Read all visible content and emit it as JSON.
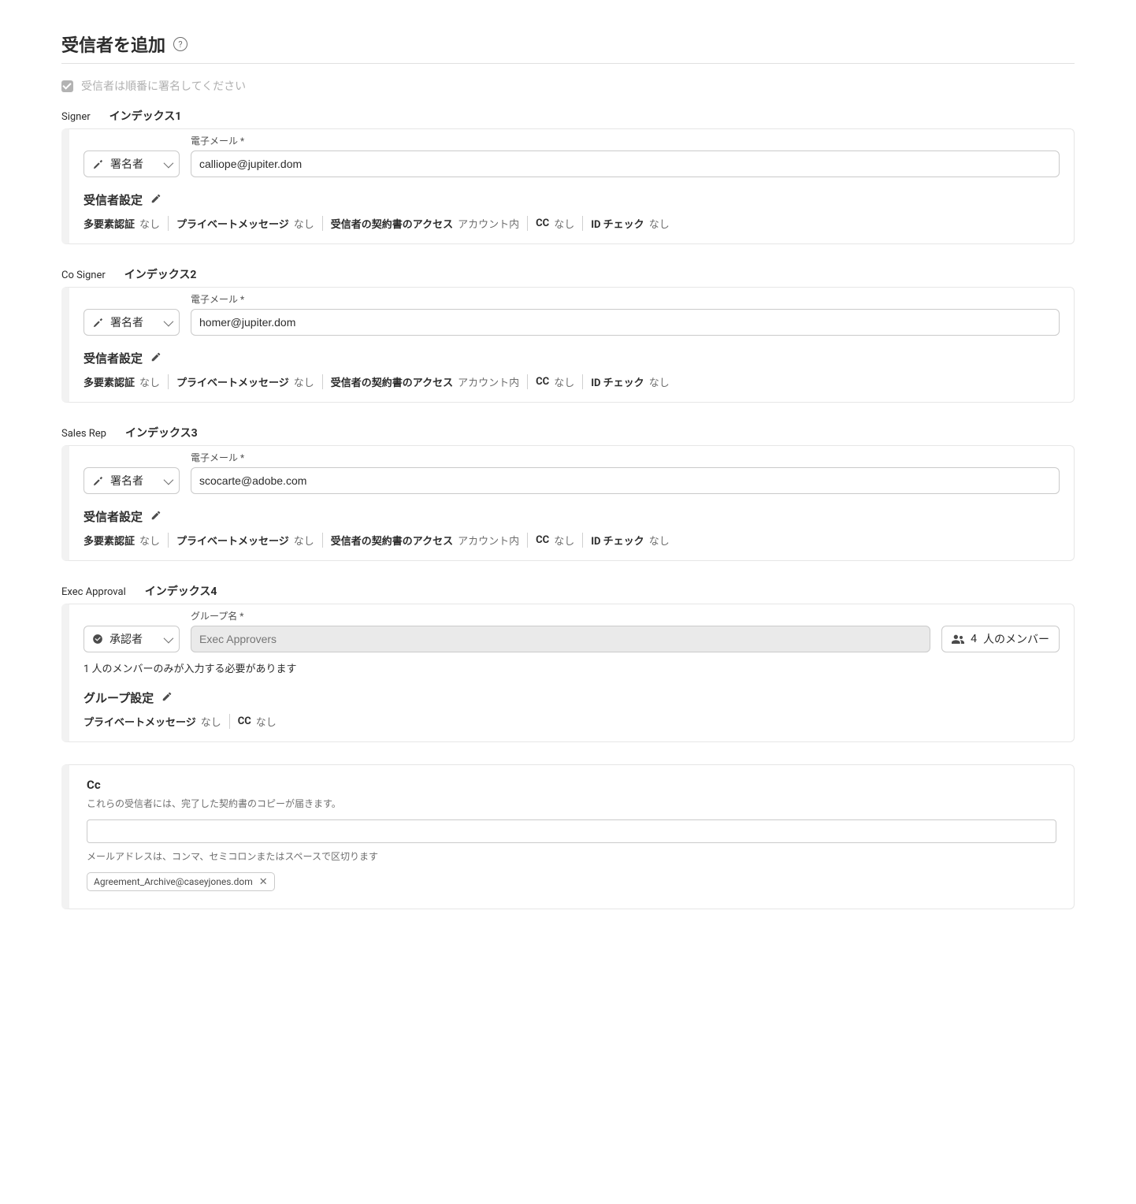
{
  "page": {
    "title": "受信者を追加",
    "orderLabel": "受信者は順番に署名してください"
  },
  "labels": {
    "email": "電子メール *",
    "groupName": "グループ名 *",
    "recipientSettings": "受信者設定",
    "groupSettings": "グループ設定",
    "mfa": "多要素認証",
    "privateMsg": "プライベートメッセージ",
    "agreementAccess": "受信者の契約書のアクセス",
    "cc": "CC",
    "idCheck": "ID チェック",
    "none": "なし",
    "withinAccount": "アカウント内",
    "signerRole": "署名者",
    "approverRole": "承認者",
    "membersSuffix": "人のメンバー"
  },
  "recipients": [
    {
      "roleName": "Signer",
      "indexLabel": "インデックス1",
      "selector": "signer",
      "email": "calliope@jupiter.dom",
      "type": "email"
    },
    {
      "roleName": "Co Signer",
      "indexLabel": "インデックス2",
      "selector": "signer",
      "email": "homer@jupiter.dom",
      "type": "email"
    },
    {
      "roleName": "Sales Rep",
      "indexLabel": "インデックス3",
      "selector": "signer",
      "email": "scocarte@adobe.com",
      "type": "email"
    },
    {
      "roleName": "Exec Approval",
      "indexLabel": "インデックス4",
      "selector": "approver",
      "groupPlaceholder": "Exec Approvers",
      "memberCount": "4",
      "note": "1 人のメンバーのみが入力する必要があります",
      "type": "group"
    }
  ],
  "ccSection": {
    "title": "Cc",
    "desc": "これらの受信者には、完了した契約書のコピーが届きます。",
    "hint": "メールアドレスは、コンマ、セミコロンまたはスペースで区切ります",
    "tags": [
      "Agreement_Archive@caseyjones.dom"
    ]
  }
}
